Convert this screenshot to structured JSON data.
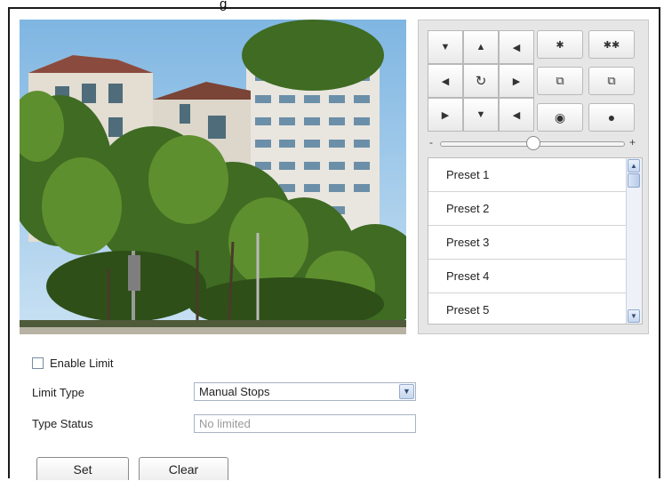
{
  "header": {
    "title_fragment": "g"
  },
  "ptz": {
    "direction_buttons": [
      {
        "name": "pan-up-left-button",
        "glyph": "▼"
      },
      {
        "name": "pan-up-button",
        "glyph": "▲"
      },
      {
        "name": "pan-up-right-button",
        "glyph": "◀"
      },
      {
        "name": "pan-left-button",
        "glyph": "◀"
      },
      {
        "name": "auto-pan-button",
        "glyph": "↻"
      },
      {
        "name": "pan-right-button",
        "glyph": "▶"
      },
      {
        "name": "pan-down-left-button",
        "glyph": "▶"
      },
      {
        "name": "pan-down-button",
        "glyph": "▼"
      },
      {
        "name": "pan-down-right-button",
        "glyph": "◀"
      }
    ],
    "lens_buttons": [
      {
        "name": "zoom-in-button",
        "glyph": "✱"
      },
      {
        "name": "zoom-out-button",
        "glyph": "✱✱"
      },
      {
        "name": "focus-near-button",
        "glyph": "⧉"
      },
      {
        "name": "focus-far-button",
        "glyph": "⧉"
      },
      {
        "name": "iris-open-button",
        "glyph": "◉"
      },
      {
        "name": "iris-close-button",
        "glyph": "●"
      }
    ],
    "speed_slider": {
      "minus": "-",
      "plus": "+",
      "level": 0.5
    }
  },
  "presets": [
    {
      "label": "Preset 1"
    },
    {
      "label": "Preset 2"
    },
    {
      "label": "Preset 3"
    },
    {
      "label": "Preset 4"
    },
    {
      "label": "Preset 5"
    }
  ],
  "form": {
    "enable_limit_label": "Enable Limit",
    "enable_limit_checked": false,
    "limit_type_label": "Limit Type",
    "limit_type_value": "Manual Stops",
    "type_status_label": "Type Status",
    "type_status_value": "No limited",
    "set_label": "Set",
    "clear_label": "Clear"
  },
  "colors": {
    "panel_bg": "#e6e6e6",
    "scroll_accent": "#93acd0"
  }
}
